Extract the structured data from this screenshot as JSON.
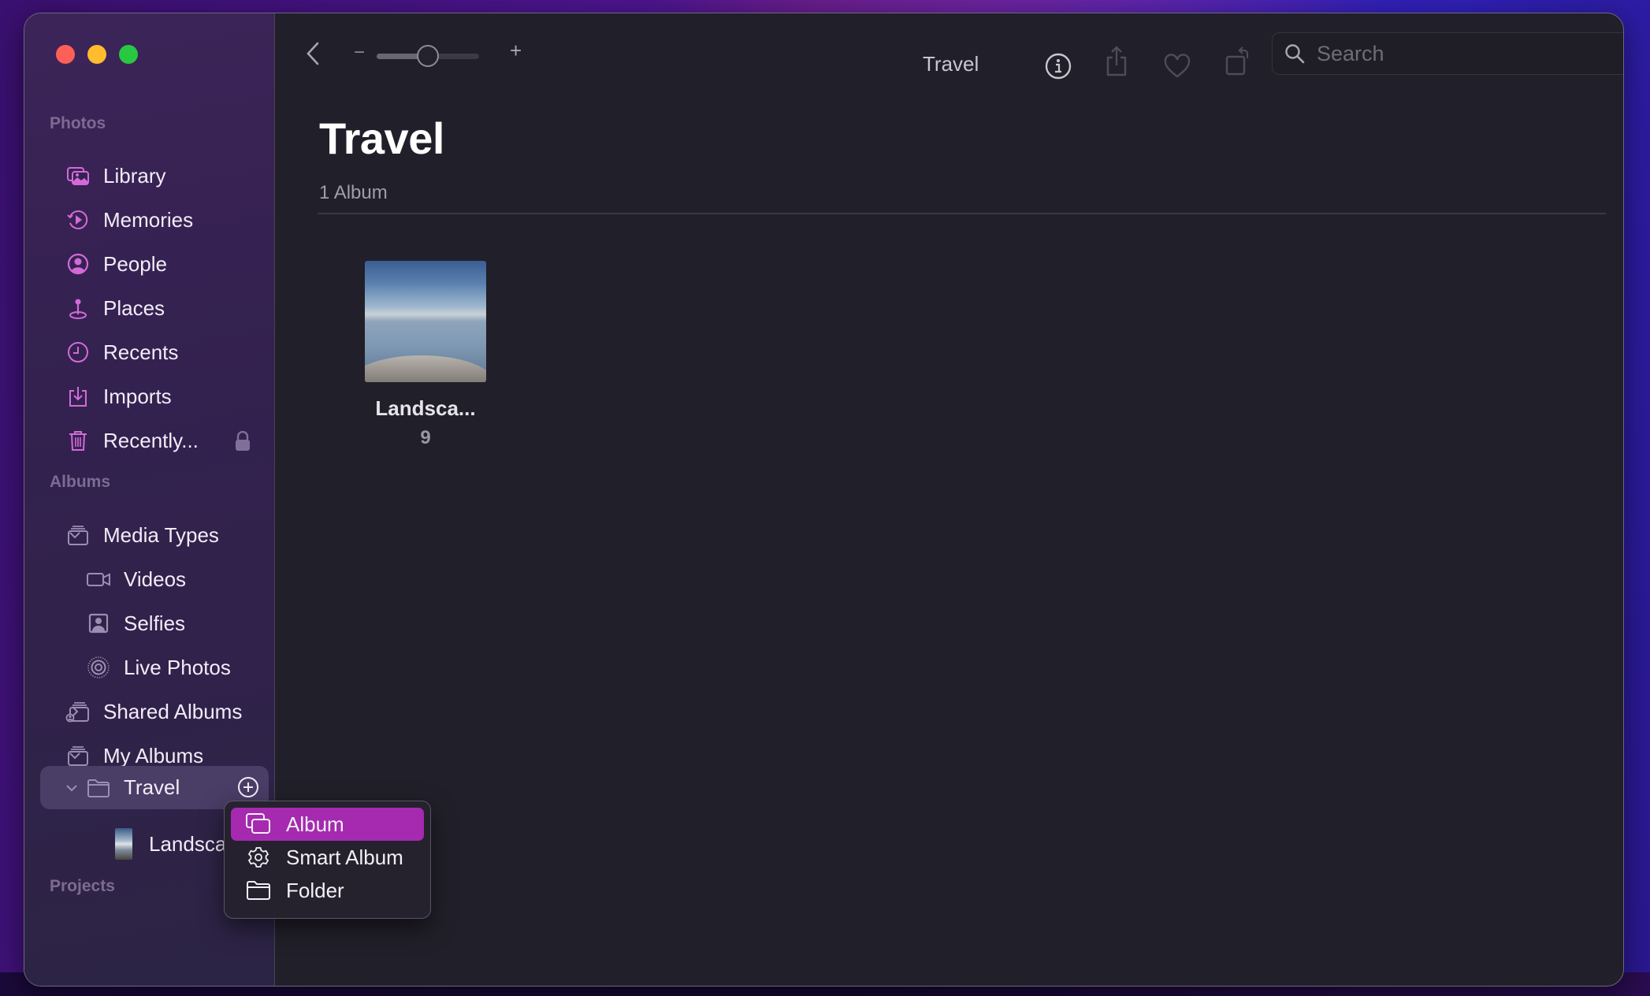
{
  "window": {
    "traffic_lights": [
      "close",
      "minimize",
      "zoom"
    ]
  },
  "sidebar": {
    "sections": {
      "photos": "Photos",
      "albums": "Albums",
      "projects": "Projects"
    },
    "photos_items": [
      {
        "label": "Library",
        "icon": "library-icon"
      },
      {
        "label": "Memories",
        "icon": "memories-icon"
      },
      {
        "label": "People",
        "icon": "people-icon"
      },
      {
        "label": "Places",
        "icon": "places-icon"
      },
      {
        "label": "Recents",
        "icon": "recents-icon"
      },
      {
        "label": "Imports",
        "icon": "imports-icon"
      },
      {
        "label": "Recently...",
        "icon": "trash-icon",
        "locked": true
      }
    ],
    "albums_items": [
      {
        "label": "Media Types",
        "icon": "album-stack-icon",
        "expanded": true
      },
      {
        "label": "Videos",
        "icon": "video-icon"
      },
      {
        "label": "Selfies",
        "icon": "selfie-icon"
      },
      {
        "label": "Live Photos",
        "icon": "live-photo-icon"
      },
      {
        "label": "Shared Albums",
        "icon": "shared-album-icon",
        "expanded": false
      },
      {
        "label": "My Albums",
        "icon": "album-stack-icon",
        "expanded": true
      },
      {
        "label": "Travel",
        "icon": "folder-icon",
        "expanded": true,
        "selected": true
      },
      {
        "label": "Landscapes",
        "icon": "album-thumbnail",
        "truncated_display": "Landsca"
      }
    ]
  },
  "toolbar": {
    "title": "Travel",
    "zoom_minus": "−",
    "zoom_plus": "+",
    "zoom_level": 0.5,
    "search_placeholder": "Search",
    "search_value": ""
  },
  "main": {
    "title": "Travel",
    "subtitle": "1 Album",
    "albums": [
      {
        "name": "Landsca...",
        "count": "9"
      }
    ]
  },
  "context_menu": {
    "items": [
      {
        "label": "Album",
        "icon": "album-icon",
        "highlighted": true
      },
      {
        "label": "Smart Album",
        "icon": "gear-icon",
        "highlighted": false
      },
      {
        "label": "Folder",
        "icon": "folder-icon",
        "highlighted": false
      }
    ]
  },
  "colors": {
    "accent": "#a52ab0",
    "sidebar_icon": "#d46ad8",
    "window_bg": "#211f29"
  }
}
